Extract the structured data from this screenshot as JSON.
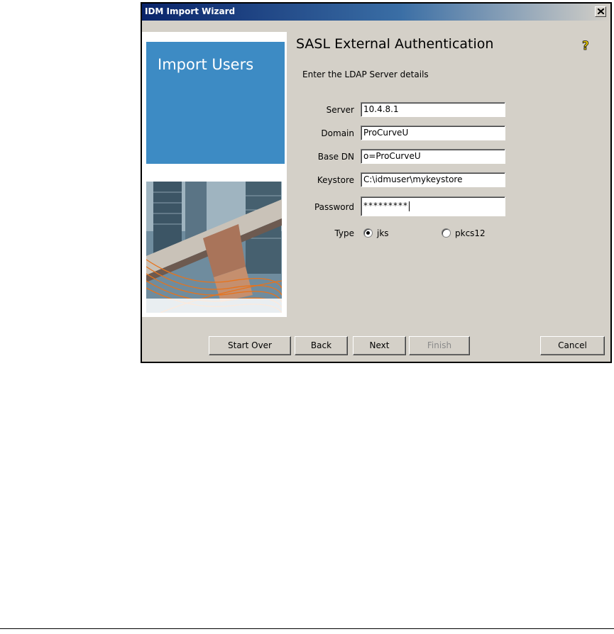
{
  "window": {
    "title": "IDM Import Wizard"
  },
  "side": {
    "heading": "Import Users"
  },
  "main": {
    "title": "SASL External Authentication",
    "subtitle": "Enter the LDAP Server details"
  },
  "fields": {
    "server": {
      "label": "Server",
      "value": "10.4.8.1"
    },
    "domain": {
      "label": "Domain",
      "value": "ProCurveU"
    },
    "base_dn": {
      "label": "Base DN",
      "value": "o=ProCurveU"
    },
    "keystore": {
      "label": "Keystore",
      "value": "C:\\idmuser\\mykeystore"
    },
    "password": {
      "label": "Password",
      "value": "*********"
    }
  },
  "type": {
    "label": "Type",
    "options": [
      {
        "label": "jks",
        "selected": true
      },
      {
        "label": "pkcs12",
        "selected": false
      }
    ]
  },
  "buttons": {
    "start_over": "Start Over",
    "back": "Back",
    "next": "Next",
    "finish": "Finish",
    "cancel": "Cancel"
  },
  "colors": {
    "title_bar": "#0a246a",
    "side_panel_blue": "#3d8bc4",
    "dialog_bg": "#d4d0c8",
    "help_icon": "#f0d000"
  },
  "icons": {
    "close": "close-icon",
    "help": "help-icon"
  }
}
